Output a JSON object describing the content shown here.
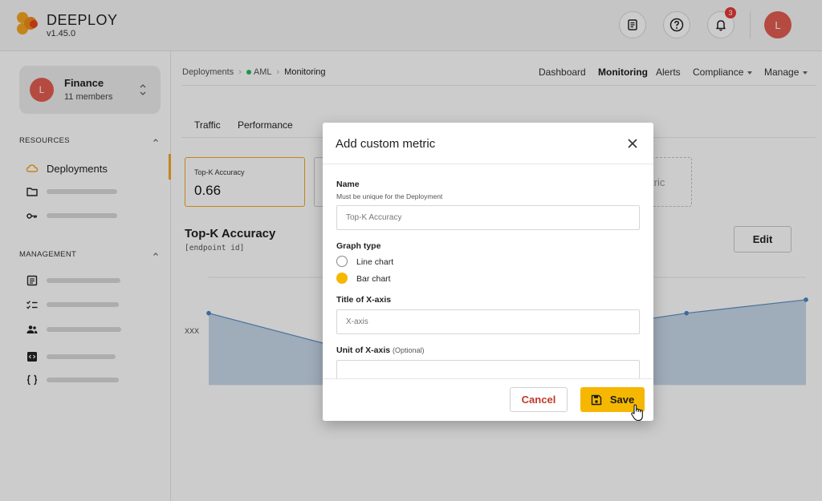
{
  "app": {
    "brand": "DEEPLOY",
    "version": "v1.45.0",
    "brand_color": "#f5a623"
  },
  "topbar": {
    "icons": [
      "docs-icon",
      "help-icon",
      "bell-icon"
    ],
    "notification_count": "3",
    "user_initial": "L"
  },
  "sidebar": {
    "workspace": {
      "initial": "L",
      "name": "Finance",
      "members": "11 members"
    },
    "resources_title": "RESOURCES",
    "management_title": "MANAGEMENT",
    "resources_items": [
      {
        "icon": "cloud-icon",
        "label": "Deployments",
        "active": true
      },
      {
        "icon": "folder-icon",
        "label": ""
      },
      {
        "icon": "key-icon",
        "label": ""
      }
    ],
    "management_items": [
      {
        "icon": "document-icon"
      },
      {
        "icon": "checklist-icon"
      },
      {
        "icon": "users-icon"
      },
      {
        "icon": "code-box-icon"
      },
      {
        "icon": "braces-icon"
      }
    ]
  },
  "breadcrumb": {
    "items": [
      "Deployments",
      "AML",
      "Monitoring"
    ],
    "status_color": "#2eb85c"
  },
  "top_nav": {
    "dashboard": "Dashboard",
    "monitoring": "Monitoring",
    "alerts": "Alerts",
    "compliance": "Compliance",
    "manage": "Manage"
  },
  "tabs": [
    "Traffic",
    "Performance"
  ],
  "metric_card": {
    "title": "Top-K Accuracy",
    "value": "0.66"
  },
  "add_metric_fragment": "tric",
  "chart": {
    "title": "Top-K Accuracy",
    "subtitle": "[endpoint id]",
    "y_label": "XXX",
    "edit_label": "Edit"
  },
  "chart_data": {
    "type": "area",
    "title": "Top-K Accuracy",
    "series": [
      {
        "values": [
          0.8,
          0.45,
          0.55,
          0.6,
          0.8,
          0.95
        ]
      }
    ],
    "ylim": [
      0,
      1.2
    ],
    "grid": true
  },
  "dialog": {
    "title": "Add custom metric",
    "name_label": "Name",
    "name_help": "Must be unique for the Deployment",
    "name_placeholder": "Top-K Accuracy",
    "graph_type_label": "Graph type",
    "options": [
      {
        "label": "Line chart",
        "selected": false
      },
      {
        "label": "Bar chart",
        "selected": true
      }
    ],
    "x_title_label": "Title of X-axis",
    "x_title_placeholder": "X-axis",
    "x_unit_label": "Unit of X-axis",
    "x_unit_optional": "(Optional)",
    "x_unit_placeholder": "",
    "cancel_label": "Cancel",
    "save_label": "Save",
    "accent": "#f5b700",
    "cancel_color": "#c0392b"
  }
}
